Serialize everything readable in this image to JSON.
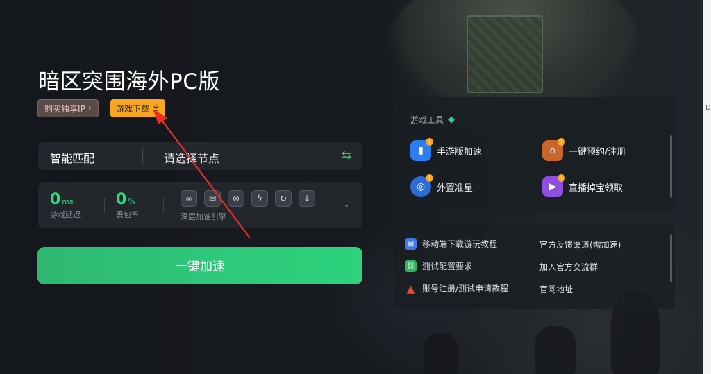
{
  "header": {
    "title": "暗区突围海外PC版",
    "buy_ip_label": "购买独享IP",
    "buy_ip_chevron": "›",
    "download_label": "游戏下载",
    "download_icon": "download-icon"
  },
  "node_bar": {
    "mode": "智能匹配",
    "node_placeholder": "请选择节点",
    "swap_icon": "swap-icon"
  },
  "stats": {
    "latency": {
      "value": "0",
      "unit": "ms",
      "label": "游戏延迟"
    },
    "loss": {
      "value": "0",
      "unit": "%",
      "label": "丢包率"
    },
    "engine_label": "深层加速引擎",
    "engine_icons": [
      "link-icon",
      "mail-icon",
      "bind-icon",
      "bolt-icon",
      "refresh-icon",
      "download-circle-icon"
    ]
  },
  "accelerate_button": "一键加速",
  "tools": {
    "title": "游戏工具",
    "items": [
      {
        "label": "手游版加速",
        "icon": "mobile-icon",
        "color": "#2d7cf0"
      },
      {
        "label": "一键预约/注册",
        "icon": "register-icon",
        "color": "#c9662c"
      },
      {
        "label": "外置准星",
        "icon": "crosshair-icon",
        "color": "#2b6cd6"
      },
      {
        "label": "直播掉宝领取",
        "icon": "live-icon",
        "color": "#8e4ee0"
      }
    ]
  },
  "links": {
    "items_left": [
      {
        "label": "移动端下载游玩教程",
        "icon": "phone-download-icon",
        "color": "#3d7be8"
      },
      {
        "label": "测试配置要求",
        "icon": "link-chain-icon",
        "color": "#2fb45f"
      },
      {
        "label": "账号注册/测试申请教程",
        "icon": "warning-icon",
        "color": "#e24a3b"
      }
    ],
    "items_right": [
      "官方反馈渠道(需加速)",
      "加入官方交流群",
      "官网地址"
    ]
  },
  "colors": {
    "accent_green": "#2fdc83",
    "download_orange": "#f6a623",
    "annotation_red": "#e8302a"
  }
}
